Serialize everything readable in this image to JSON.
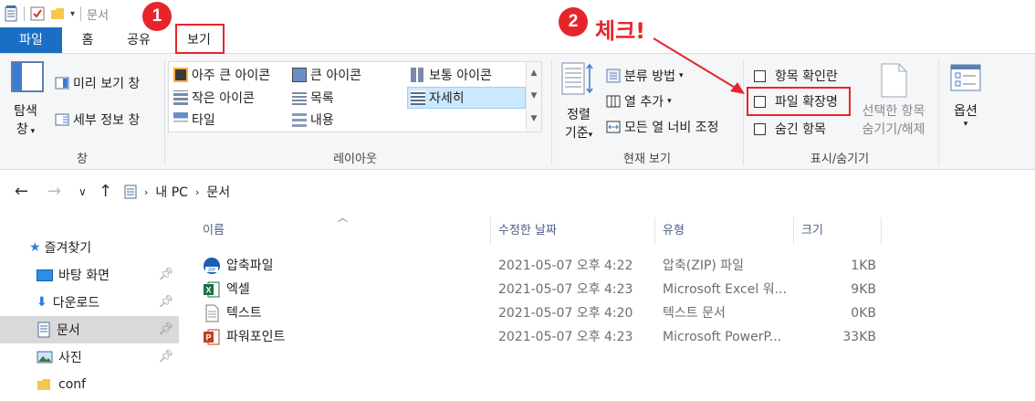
{
  "titlebar": {
    "title": "문서"
  },
  "tabs": [
    {
      "label": "파일"
    },
    {
      "label": "홈"
    },
    {
      "label": "공유"
    },
    {
      "label": "보기"
    }
  ],
  "ribbon": {
    "pane_group": {
      "nav_pane_line1": "탐색",
      "nav_pane_line2": "창",
      "preview_pane": "미리 보기 창",
      "details_pane": "세부 정보 창",
      "label": "창"
    },
    "layout_group": {
      "items": [
        "아주 큰 아이콘",
        "큰 아이콘",
        "보통 아이콘",
        "작은 아이콘",
        "목록",
        "자세히",
        "타일",
        "내용"
      ],
      "selected": "자세히",
      "label": "레이아웃"
    },
    "current_view_group": {
      "sort_line1": "정렬",
      "sort_line2": "기준",
      "group_by": "분류 방법",
      "add_columns": "열 추가",
      "fit_columns": "모든 열 너비 조정",
      "label": "현재 보기"
    },
    "show_hide_group": {
      "item_checkboxes": "항목 확인란",
      "file_extensions": "파일 확장명",
      "hidden_items": "숨긴 항목",
      "hide_selected_line1": "선택한 항목",
      "hide_selected_line2": "숨기기/해제",
      "label": "표시/숨기기"
    },
    "options": {
      "label": "옵션"
    }
  },
  "annotations": {
    "badge1": "1",
    "badge2": "2",
    "check_text": "체크!",
    "accent_color": "#e8242b"
  },
  "address": {
    "crumbs": [
      "내 PC",
      "문서"
    ]
  },
  "navpane": {
    "items": [
      {
        "label": "즐겨찾기",
        "icon": "star-icon"
      },
      {
        "label": "바탕 화면",
        "icon": "desktop-icon",
        "pinned": true
      },
      {
        "label": "다운로드",
        "icon": "download-icon",
        "pinned": true
      },
      {
        "label": "문서",
        "icon": "document-icon",
        "pinned": true,
        "active": true
      },
      {
        "label": "사진",
        "icon": "picture-icon",
        "pinned": true
      },
      {
        "label": "conf",
        "icon": "folder-icon"
      }
    ]
  },
  "filelist": {
    "columns": [
      "이름",
      "수정한 날짜",
      "유형",
      "크기"
    ],
    "rows": [
      {
        "name": "압축파일",
        "icon": "zip-icon",
        "date": "2021-05-07 오후 4:22",
        "type": "압축(ZIP) 파일",
        "size": "1KB"
      },
      {
        "name": "엑셀",
        "icon": "excel-icon",
        "date": "2021-05-07 오후 4:23",
        "type": "Microsoft Excel 워...",
        "size": "9KB"
      },
      {
        "name": "텍스트",
        "icon": "text-file-icon",
        "date": "2021-05-07 오후 4:20",
        "type": "텍스트 문서",
        "size": "0KB"
      },
      {
        "name": "파워포인트",
        "icon": "powerpoint-icon",
        "date": "2021-05-07 오후 4:23",
        "type": "Microsoft PowerP...",
        "size": "33KB"
      }
    ]
  }
}
